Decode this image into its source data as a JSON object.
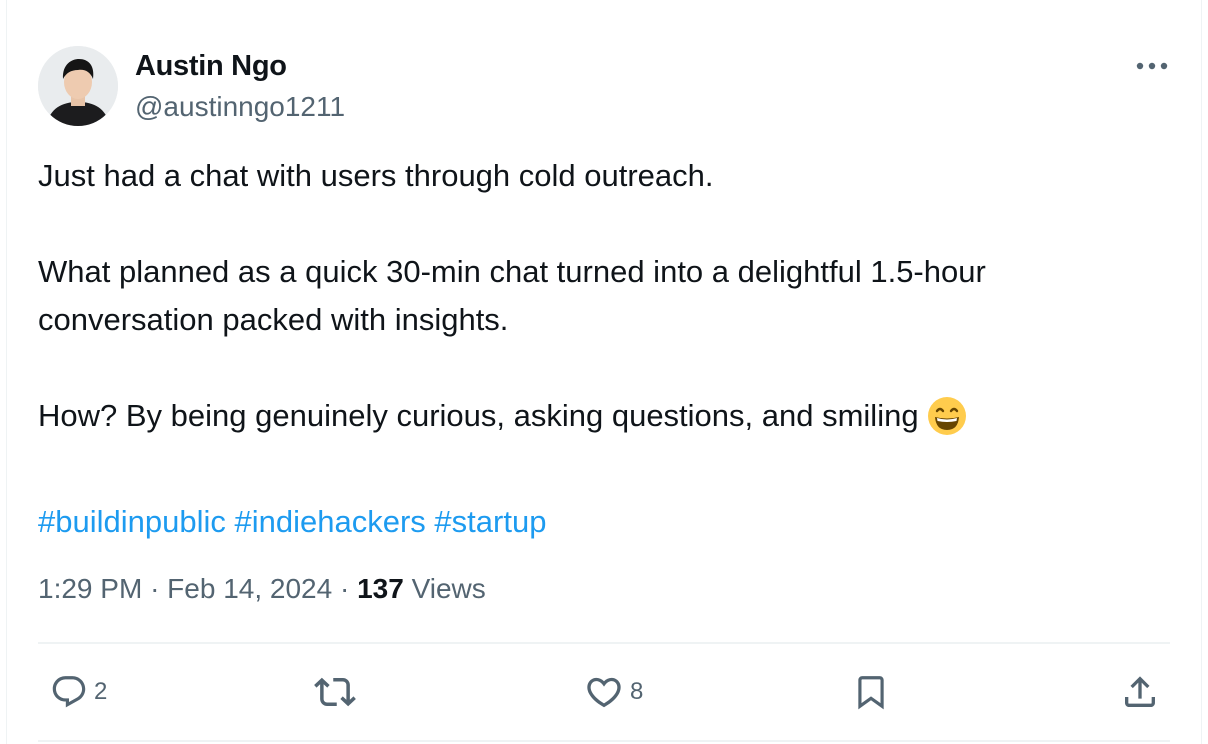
{
  "tweet": {
    "author": {
      "display_name": "Austin Ngo",
      "handle": "@austinngo1211",
      "avatar_icon": "profile-photo"
    },
    "more_icon": "more-horizontal-icon",
    "text": {
      "line1": "Just had a chat with users through cold outreach.",
      "line2": "What planned as a quick 30-min chat turned into a delightful 1.5-hour",
      "line3": "conversation packed with insights.",
      "line4": "How? By being genuinely curious, asking questions, and smiling",
      "emoji": "grinning-face-with-smiling-eyes",
      "hashtags": [
        "#buildinpublic",
        "#indiehackers",
        "#startup"
      ]
    },
    "meta": {
      "time": "1:29 PM",
      "separator": "·",
      "date": "Feb 14, 2024",
      "views_count": "137",
      "views_label": "Views"
    },
    "actions": {
      "reply_count": "2",
      "retweet_count": "",
      "like_count": "8"
    },
    "colors": {
      "text": "#0f1419",
      "secondary": "#536471",
      "link": "#1d9bf0",
      "divider": "#eff3f4"
    }
  }
}
